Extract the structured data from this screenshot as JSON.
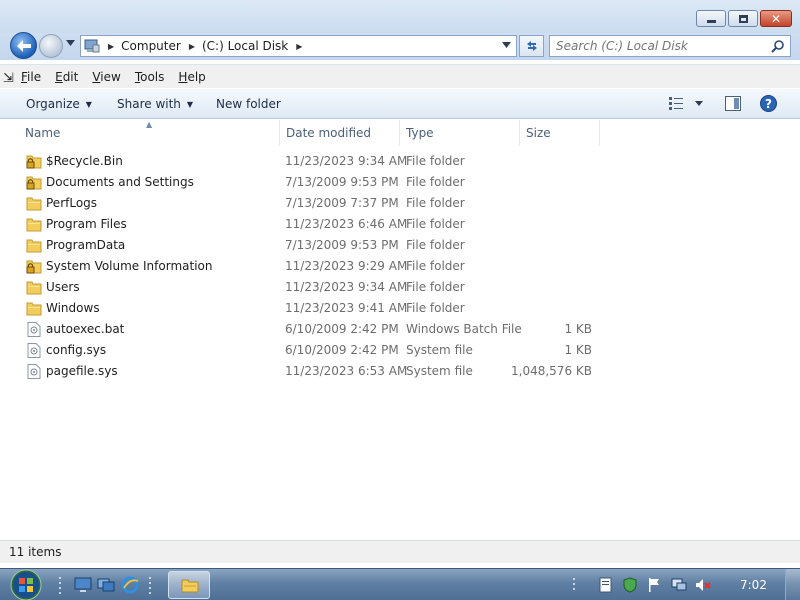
{
  "window": {
    "caption_buttons": {
      "minimize": "minimize",
      "maximize": "maximize",
      "close": "✕"
    }
  },
  "address": {
    "breadcrumbs": [
      "Computer",
      "(C:) Local Disk"
    ],
    "search_placeholder": "Search (C:) Local Disk"
  },
  "menu": {
    "items": [
      {
        "label": "File",
        "key": "F"
      },
      {
        "label": "Edit",
        "key": "E"
      },
      {
        "label": "View",
        "key": "V"
      },
      {
        "label": "Tools",
        "key": "T"
      },
      {
        "label": "Help",
        "key": "H"
      }
    ]
  },
  "toolbar": {
    "organize": "Organize",
    "share_with": "Share with",
    "new_folder": "New folder"
  },
  "columns": {
    "name": "Name",
    "date": "Date modified",
    "type": "Type",
    "size": "Size"
  },
  "files": [
    {
      "name": "$Recycle.Bin",
      "date": "11/23/2023 9:34 AM",
      "type": "File folder",
      "size": "",
      "icon": "locked-folder-icon"
    },
    {
      "name": "Documents and Settings",
      "date": "7/13/2009 9:53 PM",
      "type": "File folder",
      "size": "",
      "icon": "locked-folder-icon"
    },
    {
      "name": "PerfLogs",
      "date": "7/13/2009 7:37 PM",
      "type": "File folder",
      "size": "",
      "icon": "folder-icon"
    },
    {
      "name": "Program Files",
      "date": "11/23/2023 6:46 AM",
      "type": "File folder",
      "size": "",
      "icon": "folder-icon"
    },
    {
      "name": "ProgramData",
      "date": "7/13/2009 9:53 PM",
      "type": "File folder",
      "size": "",
      "icon": "folder-icon"
    },
    {
      "name": "System Volume Information",
      "date": "11/23/2023 9:29 AM",
      "type": "File folder",
      "size": "",
      "icon": "locked-folder-icon"
    },
    {
      "name": "Users",
      "date": "11/23/2023 9:34 AM",
      "type": "File folder",
      "size": "",
      "icon": "folder-icon"
    },
    {
      "name": "Windows",
      "date": "11/23/2023 9:41 AM",
      "type": "File folder",
      "size": "",
      "icon": "folder-icon"
    },
    {
      "name": "autoexec.bat",
      "date": "6/10/2009 2:42 PM",
      "type": "Windows Batch File",
      "size": "1 KB",
      "icon": "file-icon"
    },
    {
      "name": "config.sys",
      "date": "6/10/2009 2:42 PM",
      "type": "System file",
      "size": "1 KB",
      "icon": "file-icon"
    },
    {
      "name": "pagefile.sys",
      "date": "11/23/2023 6:53 AM",
      "type": "System file",
      "size": "1,048,576 KB",
      "icon": "file-icon"
    }
  ],
  "status": {
    "items_count": "11 items"
  },
  "taskbar": {
    "clock": "7:02"
  },
  "colors": {
    "accent": "#1d5fb5",
    "folder": "#f2cd5c",
    "taskbar": "#5f7fa3"
  }
}
